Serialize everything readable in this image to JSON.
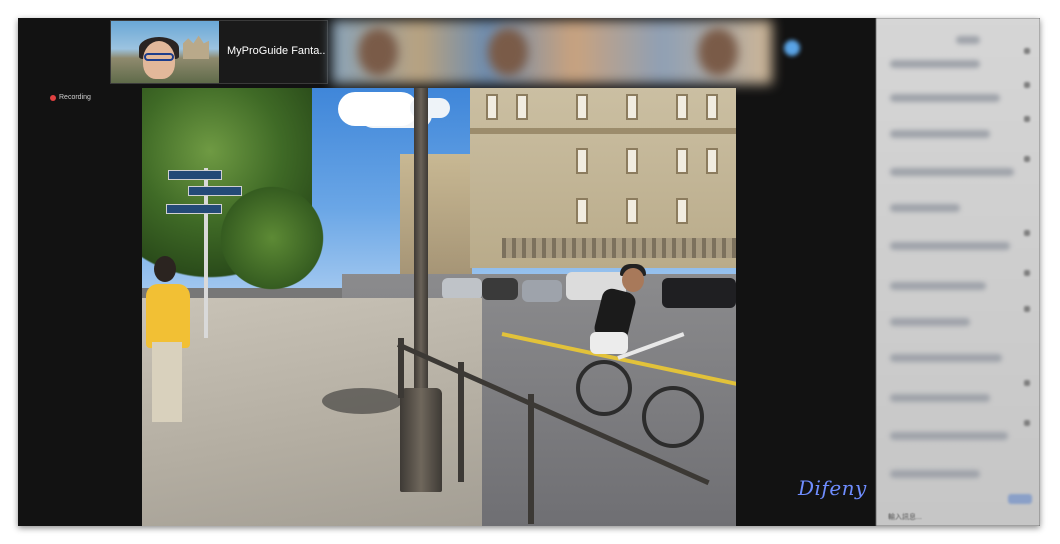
{
  "meeting": {
    "self_tile": {
      "name": "MyProGuide Fanta..."
    },
    "recording_label": "Recording"
  },
  "video": {
    "watermark": "Difeny"
  },
  "chat": {
    "input_placeholder": "輸入訊息..."
  },
  "colors": {
    "frame_bg": "#121212",
    "recording_dot": "#e04040",
    "watermark": "#6f8dff"
  }
}
